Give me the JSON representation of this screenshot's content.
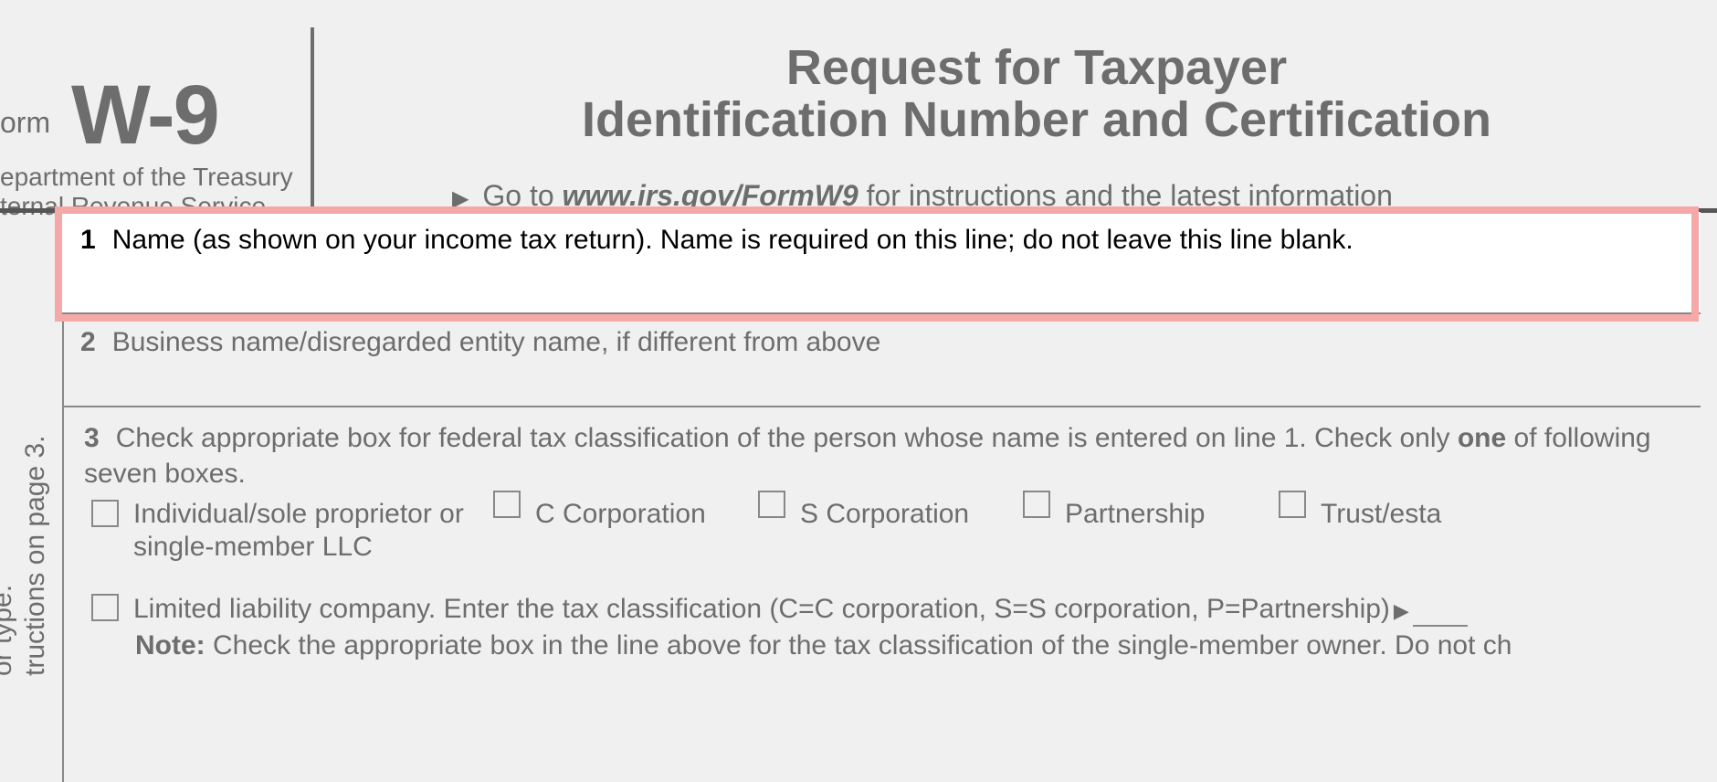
{
  "header": {
    "form_prefix": "orm",
    "form_code": "W-9",
    "dept_line1": "epartment of the Treasury",
    "dept_line2": "ternal Revenue Service",
    "title_line1": "Request for Taxpayer",
    "title_line2": "Identification Number and Certification",
    "goto_prefix": "Go to ",
    "goto_url": "www.irs.gov/FormW9",
    "goto_suffix": " for instructions and the latest information"
  },
  "line1": {
    "num": "1",
    "text": "Name (as shown on your income tax return). Name is required on this line; do not leave this line blank."
  },
  "line2": {
    "num": "2",
    "text": "Business name/disregarded entity name, if different from above"
  },
  "line3": {
    "num": "3",
    "text_part1": "Check appropriate box for federal tax classification of the person whose name is entered on line 1. Check only ",
    "text_bold": "one",
    "text_part2": " of following seven boxes."
  },
  "checkboxes": {
    "cb1": "Individual/sole proprietor or single-member LLC",
    "cb2": "C Corporation",
    "cb3": "S Corporation",
    "cb4": "Partnership",
    "cb5": "Trust/esta"
  },
  "llc": {
    "text": "Limited liability company. Enter the tax classification (C=C corporation, S=S corporation, P=Partnership)"
  },
  "note": {
    "bold": "Note:",
    "text": " Check the appropriate box in the line above for the tax classification of the single-member owner.  Do not ch"
  },
  "sidebar": {
    "text1": "tructions on page 3.",
    "text2": "or type."
  }
}
